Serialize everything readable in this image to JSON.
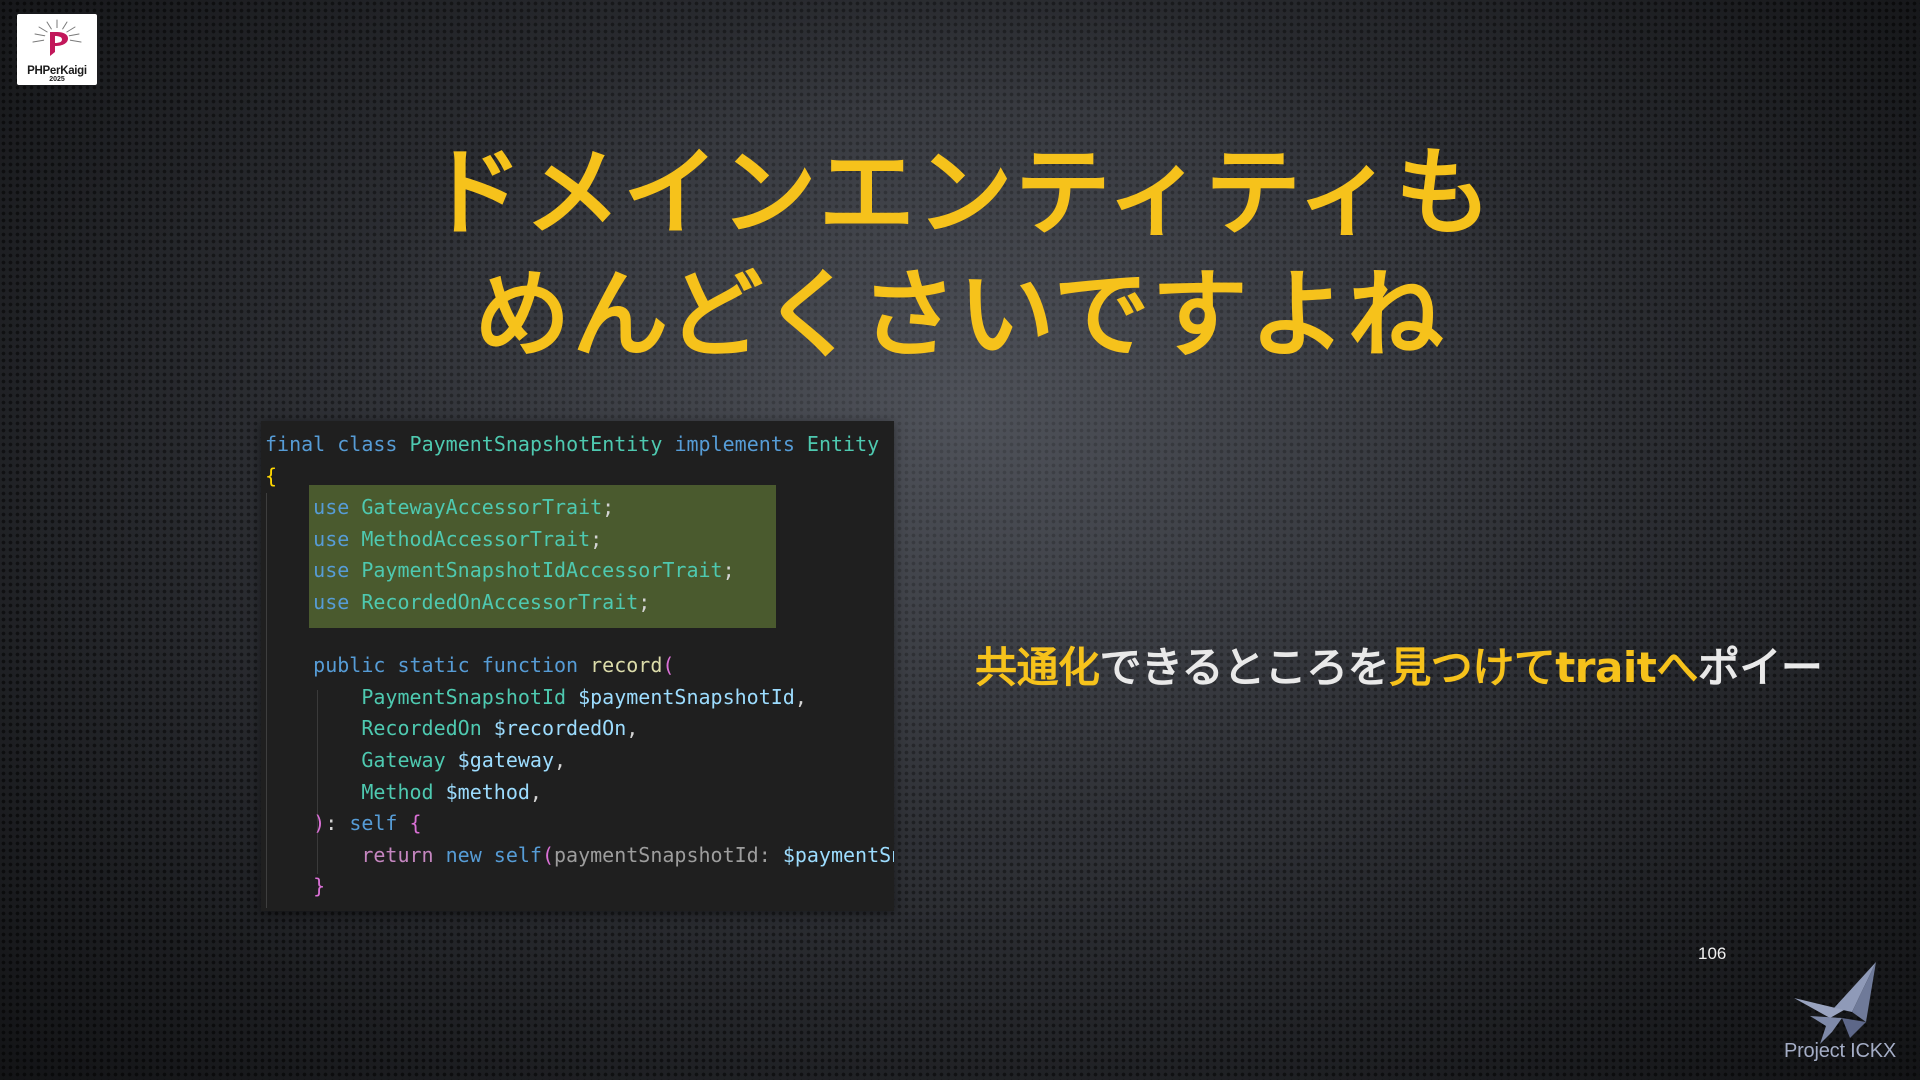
{
  "logo": {
    "name": "PHPerKaigi",
    "year": "2025"
  },
  "title": {
    "line1": "ドメインエンティティも",
    "line2": "めんどくさいですよね"
  },
  "code": {
    "lines": [
      [
        {
          "t": "final",
          "c": "kw"
        },
        {
          "t": " "
        },
        {
          "t": "class",
          "c": "kw"
        },
        {
          "t": " "
        },
        {
          "t": "PaymentSnapshotEntity",
          "c": "cls"
        },
        {
          "t": " "
        },
        {
          "t": "implements",
          "c": "kw"
        },
        {
          "t": " "
        },
        {
          "t": "Entity",
          "c": "cls"
        }
      ],
      [
        {
          "t": "{",
          "c": "brace"
        }
      ],
      [
        {
          "t": "    "
        },
        {
          "t": "use",
          "c": "kw"
        },
        {
          "t": " "
        },
        {
          "t": "GatewayAccessorTrait",
          "c": "cls"
        },
        {
          "t": ";",
          "c": "punct"
        }
      ],
      [
        {
          "t": "    "
        },
        {
          "t": "use",
          "c": "kw"
        },
        {
          "t": " "
        },
        {
          "t": "MethodAccessorTrait",
          "c": "cls"
        },
        {
          "t": ";",
          "c": "punct"
        }
      ],
      [
        {
          "t": "    "
        },
        {
          "t": "use",
          "c": "kw"
        },
        {
          "t": " "
        },
        {
          "t": "PaymentSnapshotIdAccessorTrait",
          "c": "cls"
        },
        {
          "t": ";",
          "c": "punct"
        }
      ],
      [
        {
          "t": "    "
        },
        {
          "t": "use",
          "c": "kw"
        },
        {
          "t": " "
        },
        {
          "t": "RecordedOnAccessorTrait",
          "c": "cls"
        },
        {
          "t": ";",
          "c": "punct"
        }
      ],
      [
        {
          "t": ""
        }
      ],
      [
        {
          "t": "    "
        },
        {
          "t": "public",
          "c": "kw"
        },
        {
          "t": " "
        },
        {
          "t": "static",
          "c": "kw"
        },
        {
          "t": " "
        },
        {
          "t": "function",
          "c": "kw"
        },
        {
          "t": " "
        },
        {
          "t": "record",
          "c": "fn"
        },
        {
          "t": "(",
          "c": "paren"
        }
      ],
      [
        {
          "t": "        "
        },
        {
          "t": "PaymentSnapshotId",
          "c": "cls"
        },
        {
          "t": " "
        },
        {
          "t": "$paymentSnapshotId",
          "c": "var"
        },
        {
          "t": ",",
          "c": "punct"
        }
      ],
      [
        {
          "t": "        "
        },
        {
          "t": "RecordedOn",
          "c": "cls"
        },
        {
          "t": " "
        },
        {
          "t": "$recordedOn",
          "c": "var"
        },
        {
          "t": ",",
          "c": "punct"
        }
      ],
      [
        {
          "t": "        "
        },
        {
          "t": "Gateway",
          "c": "cls"
        },
        {
          "t": " "
        },
        {
          "t": "$gateway",
          "c": "var"
        },
        {
          "t": ",",
          "c": "punct"
        }
      ],
      [
        {
          "t": "        "
        },
        {
          "t": "Method",
          "c": "cls"
        },
        {
          "t": " "
        },
        {
          "t": "$method",
          "c": "var"
        },
        {
          "t": ",",
          "c": "punct"
        }
      ],
      [
        {
          "t": "    "
        },
        {
          "t": ")",
          "c": "paren"
        },
        {
          "t": ": ",
          "c": "punct"
        },
        {
          "t": "self",
          "c": "kw"
        },
        {
          "t": " "
        },
        {
          "t": "{",
          "c": "paren"
        }
      ],
      [
        {
          "t": "        "
        },
        {
          "t": "return",
          "c": "ctl"
        },
        {
          "t": " "
        },
        {
          "t": "new",
          "c": "kw"
        },
        {
          "t": " "
        },
        {
          "t": "self",
          "c": "kw"
        },
        {
          "t": "(",
          "c": "paren"
        },
        {
          "t": "paymentSnapshotId:",
          "c": "hint"
        },
        {
          "t": " "
        },
        {
          "t": "$paymentSnapshotId",
          "c": "var"
        }
      ],
      [
        {
          "t": "    "
        },
        {
          "t": "}",
          "c": "paren"
        }
      ]
    ]
  },
  "message": {
    "parts": [
      {
        "t": "共通化",
        "c": "y"
      },
      {
        "t": "できるところを",
        "c": "w"
      },
      {
        "t": "見つけて",
        "c": "y"
      },
      {
        "t": "trait",
        "c": "y"
      },
      {
        "t": "へ",
        "c": "y"
      },
      {
        "t": "ポイー",
        "c": "w"
      }
    ]
  },
  "page_number": "106",
  "brand": {
    "text": "Project ICKX"
  },
  "colors": {
    "accent_yellow": "#f6c21b",
    "code_bg": "#1f1f1f",
    "highlight_green": "#4a5a2e",
    "brand_blue": "#a4adc6"
  }
}
